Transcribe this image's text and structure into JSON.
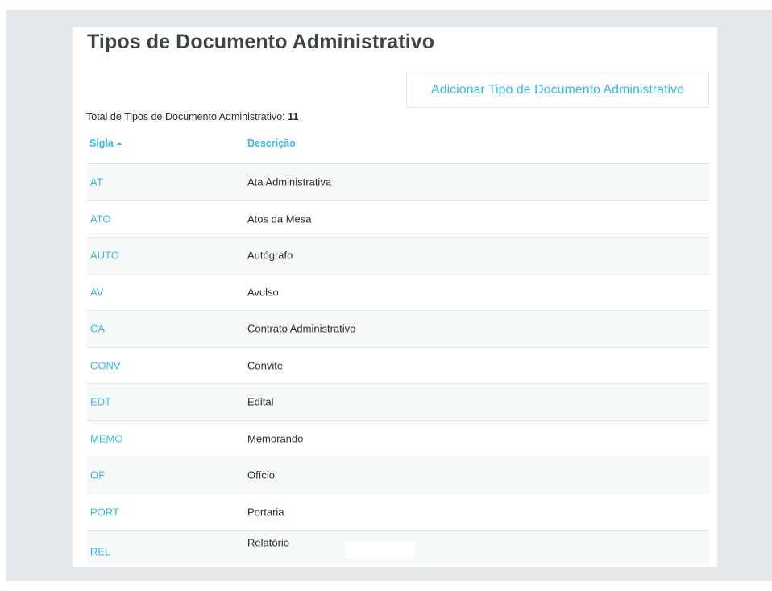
{
  "page": {
    "title": "Tipos de Documento Administrativo",
    "add_button_label": "Adicionar Tipo de Documento Administrativo",
    "total_label": "Total de Tipos de Documento Administrativo:",
    "total_value": "11"
  },
  "table": {
    "columns": [
      "Sigla",
      "Descrição"
    ],
    "sort_column": "Sigla",
    "sort_direction": "ascending",
    "rows": [
      {
        "sigla": "AT",
        "descricao": "Ata Administrativa"
      },
      {
        "sigla": "ATO",
        "descricao": "Atos da Mesa"
      },
      {
        "sigla": "AUTO",
        "descricao": "Autógrafo"
      },
      {
        "sigla": "AV",
        "descricao": "Avulso"
      },
      {
        "sigla": "CA",
        "descricao": "Contrato Administrativo"
      },
      {
        "sigla": "CONV",
        "descricao": "Convite"
      },
      {
        "sigla": "EDT",
        "descricao": "Edital"
      },
      {
        "sigla": "MEMO",
        "descricao": "Memorando"
      },
      {
        "sigla": "OF",
        "descricao": "Ofício"
      },
      {
        "sigla": "PORT",
        "descricao": "Portaria"
      },
      {
        "sigla": "REL",
        "descricao": "Relatório"
      }
    ]
  },
  "colors": {
    "accent": "#3fb6e4",
    "title": "#3e4346",
    "background": "#e6e7e8",
    "row_alt": "#f7f8f8"
  }
}
